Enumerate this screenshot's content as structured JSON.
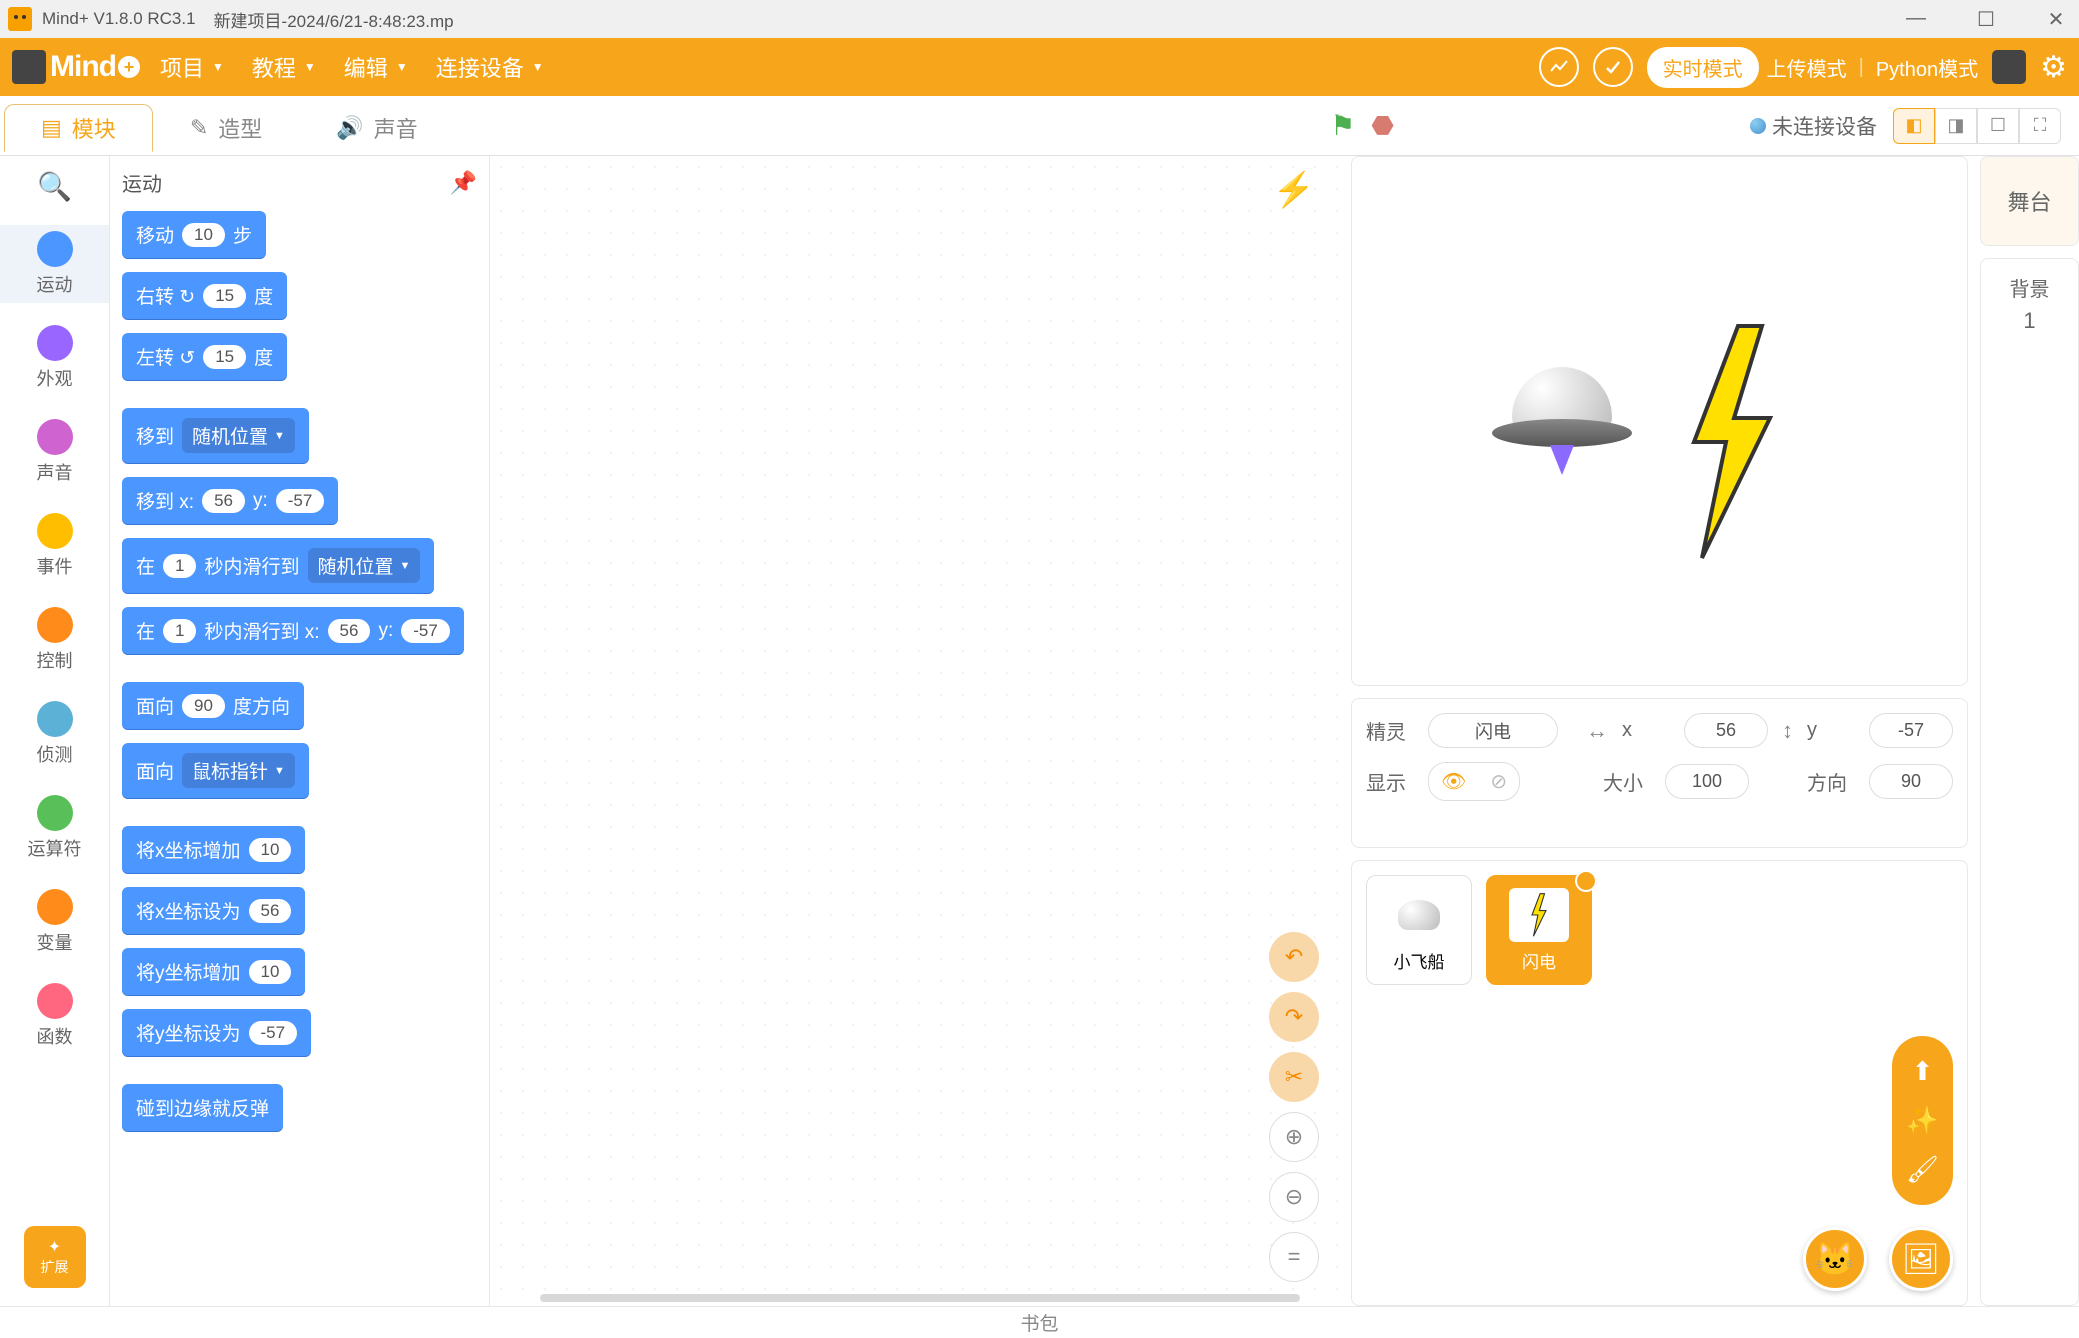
{
  "titlebar": {
    "app": "Mind+ V1.8.0 RC3.1",
    "file": "新建项目-2024/6/21-8:48:23.mp"
  },
  "menu": {
    "project": "项目",
    "tutorial": "教程",
    "edit": "编辑",
    "connect": "连接设备"
  },
  "modes": {
    "realtime": "实时模式",
    "upload": "上传模式",
    "python": "Python模式"
  },
  "tabs": {
    "blocks": "模块",
    "costumes": "造型",
    "sounds": "声音"
  },
  "connection": "未连接设备",
  "categories": {
    "motion": {
      "label": "运动",
      "color": "#4c97ff"
    },
    "looks": {
      "label": "外观",
      "color": "#9966ff"
    },
    "sound": {
      "label": "声音",
      "color": "#cf63cf"
    },
    "events": {
      "label": "事件",
      "color": "#ffbf00"
    },
    "control": {
      "label": "控制",
      "color": "#ff8c1a"
    },
    "sensing": {
      "label": "侦测",
      "color": "#5cb1d6"
    },
    "operators": {
      "label": "运算符",
      "color": "#59c059"
    },
    "variables": {
      "label": "变量",
      "color": "#ff8c1a"
    },
    "functions": {
      "label": "函数",
      "color": "#ff6680"
    }
  },
  "ext_btn": "扩展",
  "blocks_header": "运动",
  "blocks": {
    "move_a": "移动",
    "move_val": "10",
    "move_b": "步",
    "turn_r_a": "右转 ↻",
    "turn_r_val": "15",
    "turn_r_b": "度",
    "turn_l_a": "左转 ↺",
    "turn_l_val": "15",
    "turn_l_b": "度",
    "goto_a": "移到",
    "goto_opt": "随机位置",
    "goto_xy_a": "移到 x:",
    "goto_xy_x": "56",
    "goto_xy_b": "y:",
    "goto_xy_y": "-57",
    "glide_a": "在",
    "glide_sec": "1",
    "glide_b": "秒内滑行到",
    "glide_opt": "随机位置",
    "glide_xy_a": "在",
    "glide_xy_sec": "1",
    "glide_xy_b": "秒内滑行到 x:",
    "glide_xy_x": "56",
    "glide_xy_c": "y:",
    "glide_xy_y": "-57",
    "point_a": "面向",
    "point_val": "90",
    "point_b": "度方向",
    "point_to_a": "面向",
    "point_to_opt": "鼠标指针",
    "chgx_a": "将x坐标增加",
    "chgx_val": "10",
    "setx_a": "将x坐标设为",
    "setx_val": "56",
    "chgy_a": "将y坐标增加",
    "chgy_val": "10",
    "sety_a": "将y坐标设为",
    "sety_val": "-57",
    "bounce": "碰到边缘就反弹"
  },
  "sprite_info": {
    "sprite_lbl": "精灵",
    "sprite_name": "闪电",
    "x_lbl": "x",
    "x_val": "56",
    "y_lbl": "y",
    "y_val": "-57",
    "show_lbl": "显示",
    "size_lbl": "大小",
    "size_val": "100",
    "dir_lbl": "方向",
    "dir_val": "90"
  },
  "sprites": {
    "ship": "小飞船",
    "bolt": "闪电"
  },
  "stage_panel": {
    "stage": "舞台",
    "bg": "背景",
    "bg_count": "1"
  },
  "footer": "书包"
}
